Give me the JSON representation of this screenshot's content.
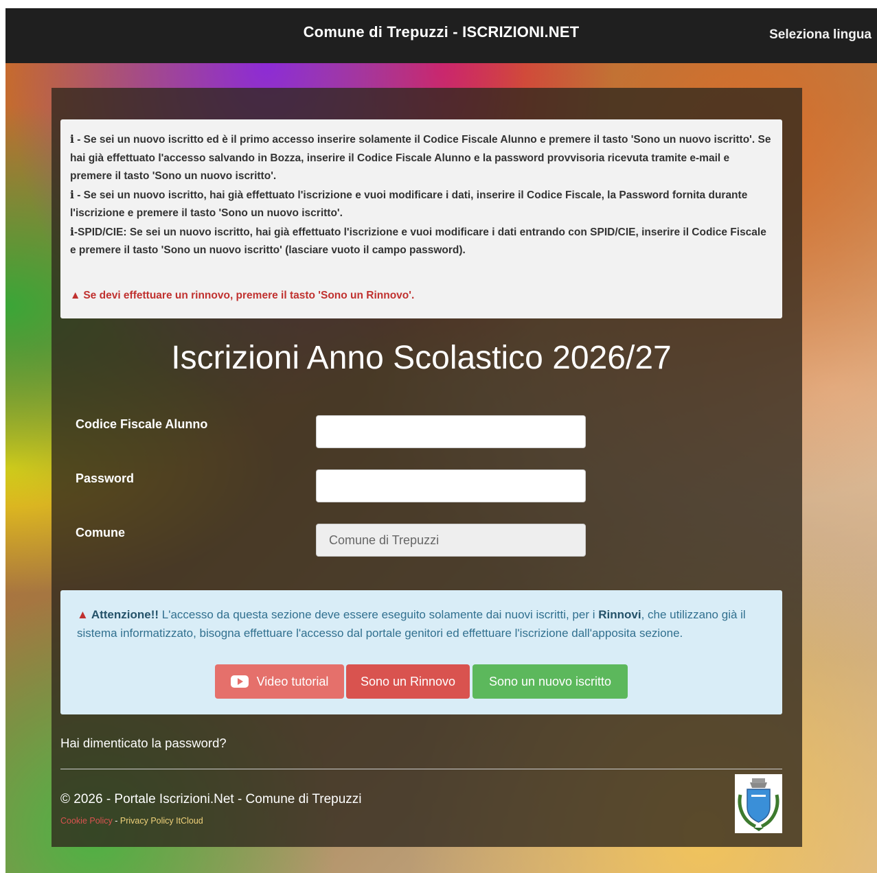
{
  "header": {
    "title": "Comune di Trepuzzi - ISCRIZIONI.NET",
    "language_label": "Seleziona lingua"
  },
  "info": {
    "line1_icon": "i",
    "line1_text": " - Se sei un nuovo iscritto ed è il primo accesso inserire solamente il Codice Fiscale Alunno e premere il tasto 'Sono un nuovo iscritto'. Se hai già effettuato l'accesso salvando in Bozza, inserire il Codice Fiscale Alunno e la password provvisoria ricevuta tramite e-mail e premere il tasto 'Sono un nuovo iscritto'.",
    "line2_icon": "i",
    "line2_text": " - Se sei un nuovo iscritto, hai già effettuato l'iscrizione e vuoi modificare i dati, inserire il Codice Fiscale, la Password fornita durante l'iscrizione e premere il tasto 'Sono un nuovo iscritto'.",
    "line3_icon": "i",
    "line3_text": "-SPID/CIE: Se sei un nuovo iscritto, hai già effettuato l'iscrizione e vuoi modificare i dati entrando con SPID/CIE, inserire il Codice Fiscale e premere il tasto 'Sono un nuovo iscritto' (lasciare vuoto il campo password).",
    "warning": "Se devi effettuare un rinnovo, premere il tasto 'Sono un Rinnovo'."
  },
  "form": {
    "heading": "Iscrizioni Anno Scolastico 2026/27",
    "codice_label": "Codice Fiscale Alunno",
    "codice_value": "",
    "password_label": "Password",
    "password_value": "",
    "comune_label": "Comune",
    "comune_value": "Comune di Trepuzzi"
  },
  "alert": {
    "strong1": "Attenzione!!",
    "text1": " L'accesso da questa sezione deve essere eseguito solamente dai nuovi iscritti, per i ",
    "strong2": "Rinnovi",
    "text2": ", che utilizzano già il sistema informatizzato, bisogna effettuare l'accesso dal portale genitori ed effettuare l'iscrizione dall'apposita sezione."
  },
  "buttons": {
    "video": "Video tutorial",
    "rinnovo": "Sono un Rinnovo",
    "nuovo": "Sono un nuovo iscritto"
  },
  "footer": {
    "forgot": "Hai dimenticato la password?",
    "copyright": "© 2026 - Portale Iscrizioni.Net - Comune di Trepuzzi",
    "cookie": "Cookie Policy",
    "separator": "-",
    "privacy": "Privacy Policy ItCloud"
  },
  "colors": {
    "topbar": "#1f1f1f",
    "danger": "#d9534f",
    "success": "#5cb85c",
    "info_bg": "#d9edf7"
  },
  "icons": [
    "info-icon",
    "warning-icon",
    "youtube-icon",
    "comune-crest-icon"
  ]
}
